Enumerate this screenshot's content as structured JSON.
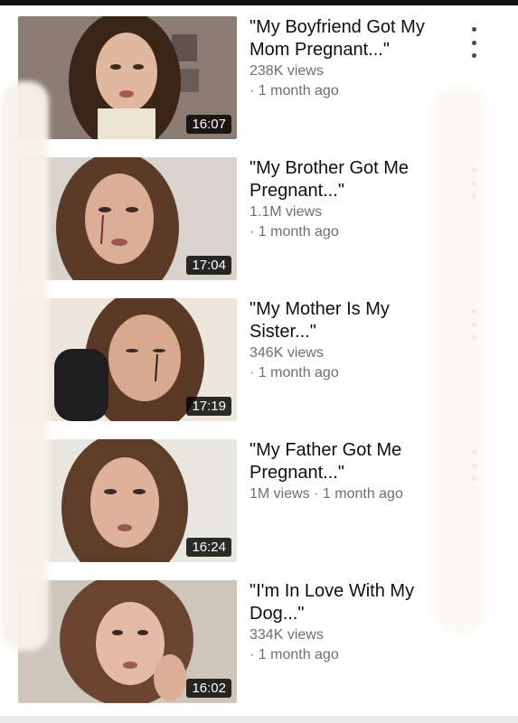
{
  "videos": [
    {
      "title_line1": "\"My Boyfriend Got My",
      "title_line2": "Mom Pregnant...\"",
      "views": "238K views",
      "age": "· 1 month ago",
      "duration": "16:07"
    },
    {
      "title_line1": "\"My Brother Got Me",
      "title_line2": "Pregnant...\"",
      "views": "1.1M views",
      "age": "· 1 month ago",
      "duration": "17:04"
    },
    {
      "title_line1": "\"My Mother Is My",
      "title_line2": "Sister...\"",
      "views": "346K views",
      "age": "· 1 month ago",
      "duration": "17:19"
    },
    {
      "title_line1": "\"My Father Got Me",
      "title_line2": "Pregnant...\"",
      "views": "1M views · 1 month ago",
      "age": "",
      "duration": "16:24"
    },
    {
      "title_line1": "\"I'm In Love With My",
      "title_line2": "Dog...\"",
      "views": "334K views",
      "age": "· 1 month ago",
      "duration": "16:02"
    }
  ],
  "icons": {
    "more": "more-vert-icon"
  }
}
